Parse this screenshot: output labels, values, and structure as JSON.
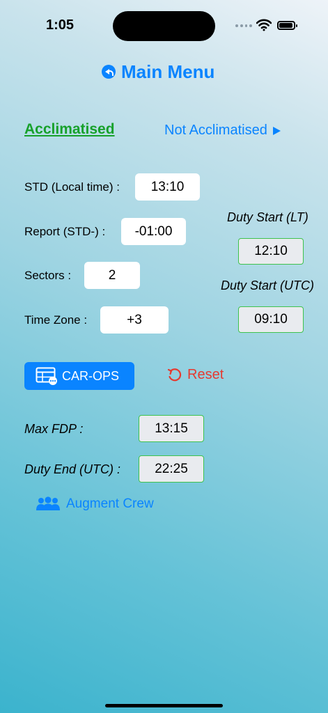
{
  "status_bar": {
    "time": "1:05"
  },
  "nav": {
    "main_menu": "Main Menu"
  },
  "tabs": {
    "acclimatised": "Acclimatised",
    "not_acclimatised": "Not Acclimatised"
  },
  "fields": {
    "std": {
      "label": "STD (Local time) :",
      "value": "13:10"
    },
    "report": {
      "label": "Report (STD-) :",
      "value": "-01:00"
    },
    "sectors": {
      "label": "Sectors :",
      "value": "2"
    },
    "time_zone": {
      "label": "Time Zone :",
      "value": "+3"
    }
  },
  "duty_start": {
    "lt_label": "Duty Start (LT)",
    "lt_value": "12:10",
    "utc_label": "Duty Start (UTC)",
    "utc_value": "09:10"
  },
  "actions": {
    "carops": "CAR-OPS",
    "reset": "Reset"
  },
  "results": {
    "max_fdp_label": "Max FDP :",
    "max_fdp_value": "13:15",
    "duty_end_label": "Duty End (UTC) :",
    "duty_end_value": "22:25"
  },
  "augment": {
    "label": "Augment Crew"
  },
  "icons": [
    "back-icon",
    "play-triangle-icon",
    "table-icon",
    "reset-icon",
    "people-icon",
    "wifi-icon",
    "battery-icon",
    "signal-icon"
  ],
  "colors": {
    "accent": "#0a84ff",
    "green": "#17a12b",
    "red": "#e63a30"
  }
}
